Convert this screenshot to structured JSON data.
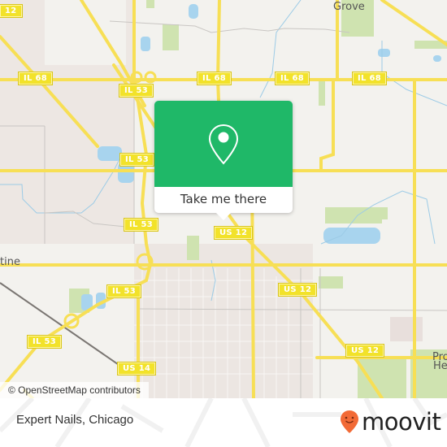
{
  "map": {
    "attribution": "© OpenStreetMap contributors",
    "route_shields": [
      {
        "id": "us12-nw",
        "label": "12"
      },
      {
        "id": "il68-a",
        "label": "IL 68"
      },
      {
        "id": "il68-b",
        "label": "IL 68"
      },
      {
        "id": "il68-c",
        "label": "IL 68"
      },
      {
        "id": "il68-d",
        "label": "IL 68"
      },
      {
        "id": "il53-a",
        "label": "IL 53"
      },
      {
        "id": "il53-b",
        "label": "IL 53"
      },
      {
        "id": "il53-c",
        "label": "IL 53"
      },
      {
        "id": "il53-d",
        "label": "IL 53"
      },
      {
        "id": "il53-e",
        "label": "IL 53"
      },
      {
        "id": "us12-a",
        "label": "US 12"
      },
      {
        "id": "us12-b",
        "label": "US 12"
      },
      {
        "id": "us12-c",
        "label": "US 12"
      },
      {
        "id": "us14",
        "label": "US 14"
      }
    ],
    "place_labels": {
      "buffalo_grove": "Grove",
      "palatine": "tine",
      "prospect_heights_1": "Pro",
      "prospect_heights_2": "He"
    }
  },
  "popup": {
    "icon": "location-pin-icon",
    "button_label": "Take me there",
    "color": "#1fb868"
  },
  "footer": {
    "place_name": "Expert Nails, Chicago",
    "brand": "moovit",
    "brand_color": "#f26a36"
  }
}
